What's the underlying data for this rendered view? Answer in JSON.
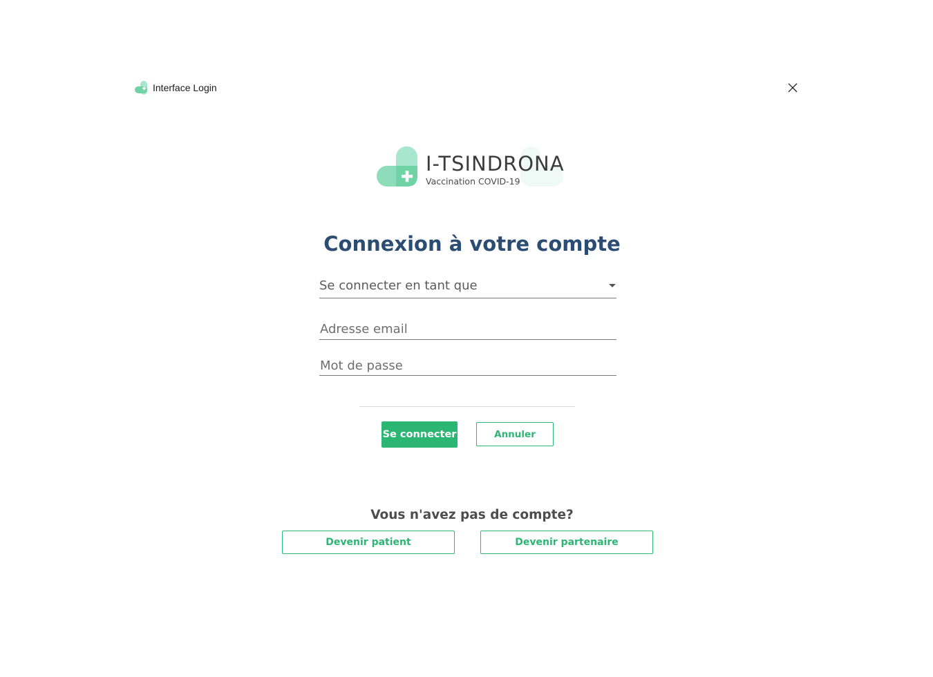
{
  "window": {
    "title": "Interface Login"
  },
  "logo": {
    "name": "I-TSINDRONA",
    "subtitle": "Vaccination COVID-19"
  },
  "form": {
    "heading": "Connexion à votre compte",
    "role_select_label": "Se connecter en tant que",
    "email_placeholder": "Adresse email",
    "email_value": "",
    "password_placeholder": "Mot de passe",
    "password_value": "",
    "submit_label": "Se connecter",
    "cancel_label": "Annuler"
  },
  "signup": {
    "prompt": "Vous n'avez pas de compte?",
    "patient_label": "Devenir patient",
    "partner_label": "Devenir partenaire"
  },
  "icons": {
    "app": "app-logo-icon",
    "close": "close-icon",
    "dropdown": "chevron-down-icon"
  },
  "colors": {
    "accent": "#2bb673",
    "heading": "#2c4d73",
    "logo_light": "#a8e6cf",
    "logo_mid": "#6fd3a6"
  }
}
